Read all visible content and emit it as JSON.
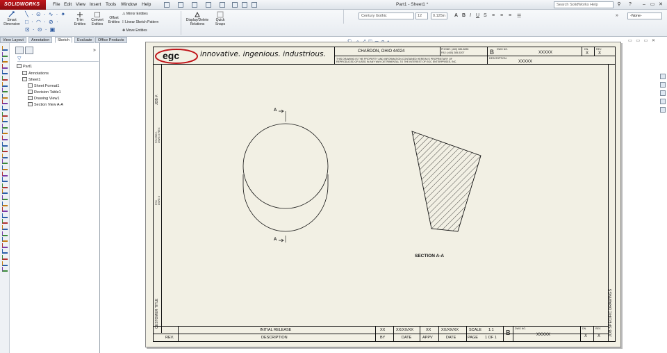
{
  "app": {
    "logo_text": "SOLIDWORKS",
    "menus": [
      "File",
      "Edit",
      "View",
      "Insert",
      "Tools",
      "Window",
      "Help"
    ],
    "doc_title": "Part1 - Sheet1 *",
    "search_placeholder": "Search SolidWorks Help",
    "window_buttons": [
      "–",
      "▭",
      "✕"
    ]
  },
  "command_manager": {
    "smart_dimension": "Smart Dimension",
    "trim_entities": "Trim Entities",
    "convert_entities": "Convert Entities",
    "offset_entities": "Offset Entities",
    "mirror_entities": "Mirror Entities",
    "linear_sketch_pattern": "Linear Sketch Pattern",
    "move_entities": "Move Entities",
    "display_delete_relations": "Display/Delete Relations",
    "quick_snaps": "Quick Snaps",
    "font_name": "Century Gothic",
    "font_size": "12",
    "text_height": "0.125in",
    "layer": "-None-"
  },
  "tabs": [
    "View Layout",
    "Annotation",
    "Sketch",
    "Evaluate",
    "Office Products"
  ],
  "active_tab": "Sketch",
  "feature_tree": {
    "root": "Part1",
    "items": [
      {
        "label": "Annotations",
        "indent": 1
      },
      {
        "label": "Sheet1",
        "indent": 1
      },
      {
        "label": "Sheet Format1",
        "indent": 2
      },
      {
        "label": "Revision Table1",
        "indent": 2
      },
      {
        "label": "Drawing View1",
        "indent": 2
      },
      {
        "label": "Section View A-A",
        "indent": 2
      }
    ]
  },
  "drawing": {
    "slogan": "innovative. ingenious. industrious.",
    "logo_text": "egc",
    "city": "CHARDON, OHIO 44024",
    "phone": "PHONE: (440) 285-5835",
    "fax": "FAX: (440) 285-5207",
    "notice_line1": "THIS DRAWING IS THE PROPERTY AND INFORMATION CONTAINED HEREIN IS PROPRIETARY OF",
    "notice_line2": "REPRODUCED OR USED IN ANY WAY DETRIMENTAL TO THE INTEREST OF EGC ENTERPRISES, INC.",
    "size_letter": "B",
    "dwg_no_label": "DWG NO.",
    "dwg_no": "XXXXX",
    "rev_label": "REV.",
    "dn_label": "DN.",
    "rev_value": "X",
    "dn_value": "X",
    "description_label": "DESCRIPTION:",
    "description_value": "XXXXX",
    "job_label": "JOB #:",
    "pn_label": "P/N REV.",
    "pn_rev": "DWG # REV.",
    "pn_label2": "P/N",
    "dwg_label2": "DWG #",
    "customer_label": "CUSTOMER TITLE",
    "job_specific": "JOB SPECIFIC DRAWINGS",
    "section_label_top": "A",
    "section_label_bottom": "A",
    "section_caption": "SECTION A-A",
    "revision_row": {
      "description": "INITIAL RELEASE",
      "by": "XX",
      "date": "XX/XX/XX",
      "appv": "XX",
      "date2": "XX/XX/XX",
      "scale_label": "SCALE",
      "scale": "1:1"
    },
    "revision_headers": {
      "rev": "REV.",
      "description": "DESCRIPTION",
      "by": "BY",
      "date": "DATE",
      "appv": "APPV",
      "date2": "DATE",
      "page_label": "PAGE",
      "page": "1 OF 1"
    },
    "bottom_block": {
      "size": "B",
      "dwg_no_label": "DWG NO.",
      "dwg_no": "XXXXX",
      "dn_label": "DN.",
      "rev_label": "REV.",
      "dn": "X",
      "rev": "X"
    }
  },
  "colors": {
    "sheet_background": "#f2f0e4",
    "logo_red": "#c0161b",
    "accent_blue": "#1f4f9a"
  }
}
